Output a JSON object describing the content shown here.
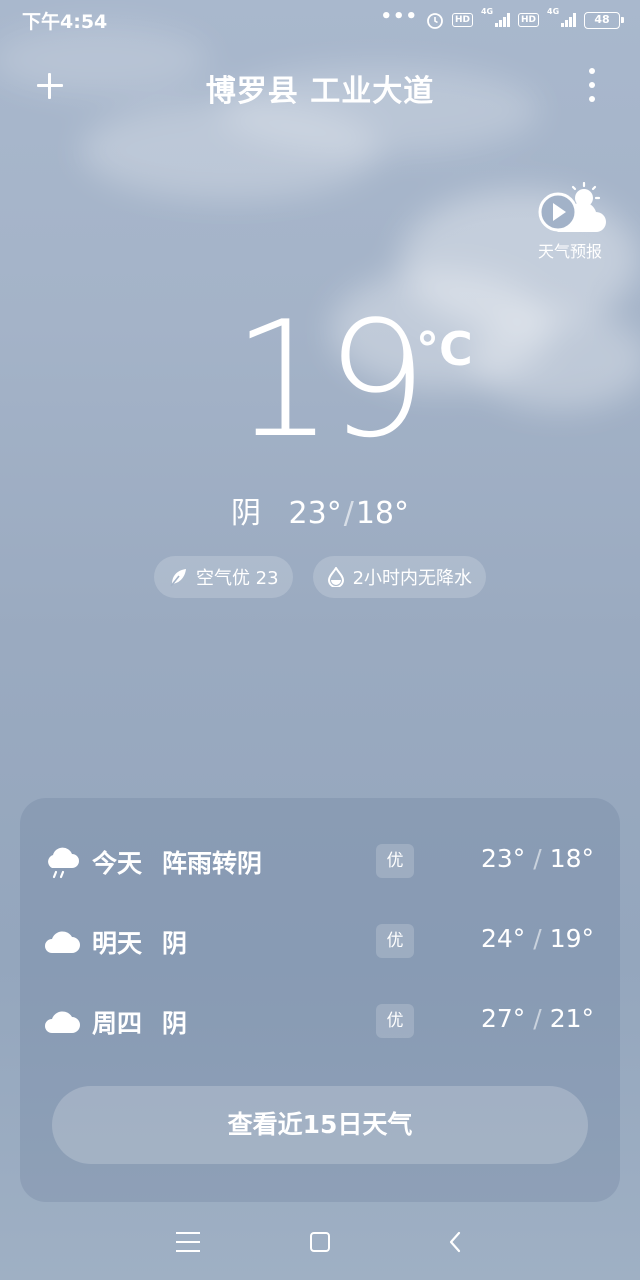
{
  "status_bar": {
    "time": "下午4:54",
    "dots": "•••",
    "hd1": "HD",
    "net1": "4G",
    "hd2": "HD",
    "net2": "4G",
    "battery": "48"
  },
  "header": {
    "location": "博罗县 工业大道",
    "add_icon": "plus-icon",
    "more_icon": "more-vertical-icon"
  },
  "forecast_video": {
    "label": "天气预报",
    "icon": "play-sun-cloud-icon"
  },
  "current": {
    "temperature": "19",
    "unit": "°C",
    "condition": "阴",
    "high": "23°",
    "low": "18°",
    "separator": "/"
  },
  "chips": {
    "air_quality": "空气优 23",
    "precipitation": "2小时内无降水"
  },
  "forecast": {
    "days": [
      {
        "day": "今天",
        "condition": "阵雨转阴",
        "aq": "优",
        "high": "23°",
        "low": "18°",
        "icon": "rain-cloud-icon"
      },
      {
        "day": "明天",
        "condition": "阴",
        "aq": "优",
        "high": "24°",
        "low": "19°",
        "icon": "cloud-icon"
      },
      {
        "day": "周四",
        "condition": "阴",
        "aq": "优",
        "high": "27°",
        "low": "21°",
        "icon": "cloud-icon"
      }
    ],
    "separator": "/",
    "button_label": "查看近15日天气"
  }
}
